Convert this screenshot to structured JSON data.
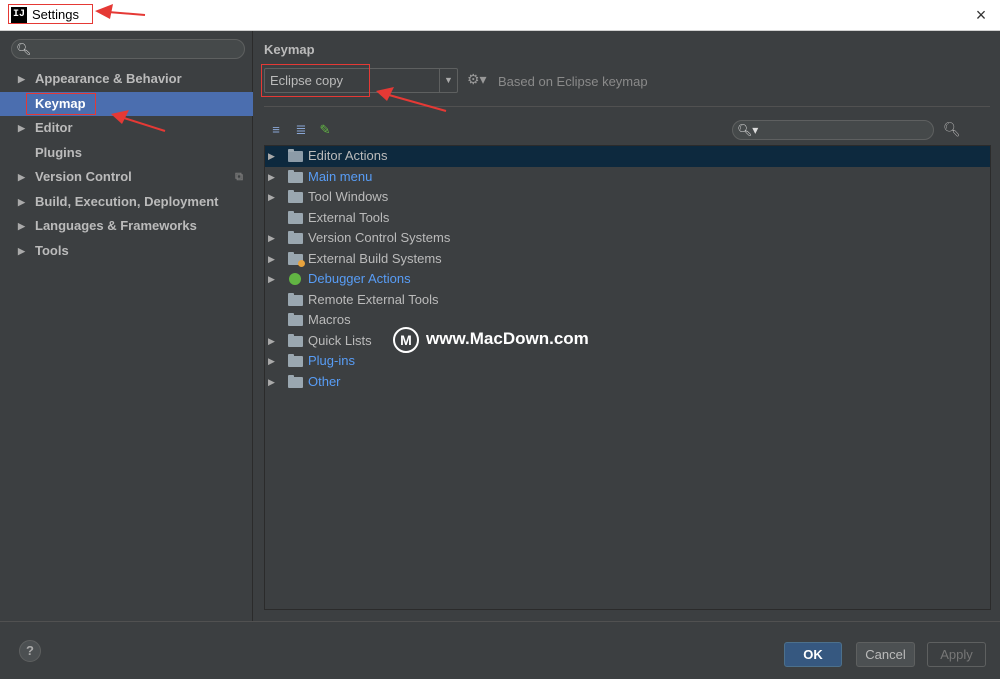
{
  "window": {
    "app_icon": "IJ",
    "title": "Settings",
    "close_icon": "×"
  },
  "sidebar": {
    "search_icon": "search-icon",
    "items": [
      {
        "label": "Appearance & Behavior",
        "expandable": true,
        "selected": false
      },
      {
        "label": "Keymap",
        "expandable": false,
        "selected": true
      },
      {
        "label": "Editor",
        "expandable": true,
        "selected": false
      },
      {
        "label": "Plugins",
        "expandable": false,
        "selected": false
      },
      {
        "label": "Version Control",
        "expandable": true,
        "selected": false,
        "project_icon": true
      },
      {
        "label": "Build, Execution, Deployment",
        "expandable": true,
        "selected": false
      },
      {
        "label": "Languages & Frameworks",
        "expandable": true,
        "selected": false
      },
      {
        "label": "Tools",
        "expandable": true,
        "selected": false
      }
    ]
  },
  "main": {
    "title": "Keymap",
    "keymap_select": {
      "value": "Eclipse copy"
    },
    "based_on": "Based on Eclipse keymap",
    "toolbar": [
      "expand-all-icon",
      "collapse-all-icon",
      "edit-icon"
    ],
    "actions": [
      {
        "label": "Editor Actions",
        "expandable": true,
        "icon": "folder-edit",
        "color": "normal",
        "selected": true
      },
      {
        "label": "Main menu",
        "expandable": true,
        "icon": "folder",
        "color": "blue",
        "selected": false
      },
      {
        "label": "Tool Windows",
        "expandable": true,
        "icon": "folder",
        "color": "normal",
        "selected": false
      },
      {
        "label": "External Tools",
        "expandable": false,
        "icon": "folder",
        "color": "normal",
        "selected": false
      },
      {
        "label": "Version Control Systems",
        "expandable": true,
        "icon": "folder",
        "color": "normal",
        "selected": false
      },
      {
        "label": "External Build Systems",
        "expandable": true,
        "icon": "folder-build",
        "color": "normal",
        "selected": false
      },
      {
        "label": "Debugger Actions",
        "expandable": true,
        "icon": "bug",
        "color": "blue",
        "selected": false
      },
      {
        "label": "Remote External Tools",
        "expandable": false,
        "icon": "folder",
        "color": "normal",
        "selected": false
      },
      {
        "label": "Macros",
        "expandable": false,
        "icon": "folder",
        "color": "normal",
        "selected": false
      },
      {
        "label": "Quick Lists",
        "expandable": true,
        "icon": "folder",
        "color": "normal",
        "selected": false
      },
      {
        "label": "Plug-ins",
        "expandable": true,
        "icon": "folder",
        "color": "blue",
        "selected": false
      },
      {
        "label": "Other",
        "expandable": true,
        "icon": "folder-other",
        "color": "blue",
        "selected": false
      }
    ]
  },
  "watermark": {
    "logo": "M",
    "text": "www.MacDown.com"
  },
  "footer": {
    "help_label": "?",
    "ok_label": "OK",
    "cancel_label": "Cancel",
    "apply_label": "Apply"
  },
  "colors": {
    "background": "#3c3f41",
    "selection": "#4b6eaf",
    "tree_selection": "#0d293e",
    "link_blue": "#589df6",
    "annotation_red": "#e53935"
  }
}
